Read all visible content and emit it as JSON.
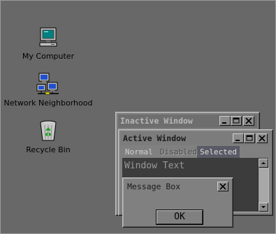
{
  "desktop": {
    "icons": [
      {
        "label": "My Computer",
        "icon": "my-computer-icon"
      },
      {
        "label": "Network Neighborhood",
        "icon": "network-neighborhood-icon"
      },
      {
        "label": "Recycle Bin",
        "icon": "recycle-bin-icon"
      }
    ]
  },
  "inactive_window": {
    "title": "Inactive Window",
    "buttons": [
      "minimize",
      "maximize",
      "close"
    ]
  },
  "active_window": {
    "title": "Active Window",
    "buttons": [
      "minimize",
      "maximize",
      "close"
    ],
    "menu": {
      "normal": "Normal",
      "disabled": "Disabled",
      "selected": "Selected"
    },
    "window_text": "Window Text"
  },
  "message_box": {
    "title": "Message Box",
    "ok_label": "OK"
  },
  "colors": {
    "desktop": "#686868",
    "window_face": "#808080",
    "selected_menu": "#5a5a66",
    "client_area": "#3c3c3c"
  }
}
